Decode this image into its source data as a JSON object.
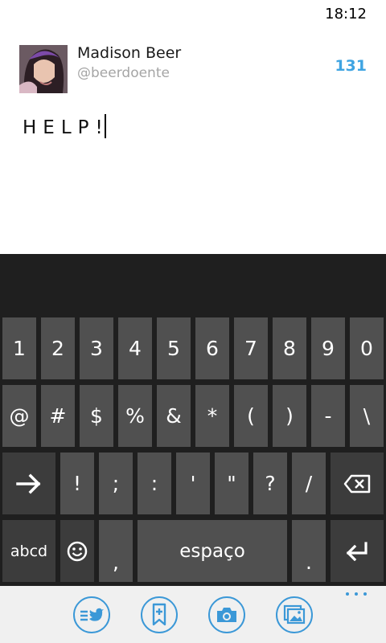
{
  "status_bar": {
    "time": "18:12"
  },
  "compose": {
    "author_name": "Madison Beer",
    "author_handle": "@beerdoente",
    "char_count": "131",
    "tweet_text": "HELP!"
  },
  "keyboard": {
    "row1": [
      "1",
      "2",
      "3",
      "4",
      "5",
      "6",
      "7",
      "8",
      "9",
      "0"
    ],
    "row2": [
      "@",
      "#",
      "$",
      "%",
      "&",
      "*",
      "(",
      ")",
      "-",
      "\\"
    ],
    "row3": [
      "!",
      ";",
      ":",
      "'",
      "\"",
      "?",
      "/"
    ],
    "abc_label": "abcd",
    "comma_label": ",",
    "space_label": "espaço",
    "period_label": "."
  },
  "app_bar": {
    "buttons": [
      "post-tweet-icon",
      "add-hashtag-icon",
      "camera-icon",
      "picture-gallery-icon"
    ],
    "accent_color": "#3b98d7"
  },
  "colors": {
    "key": "#505050",
    "keyboard_bg": "#1f1f1f",
    "accent": "#3fa4e2"
  }
}
